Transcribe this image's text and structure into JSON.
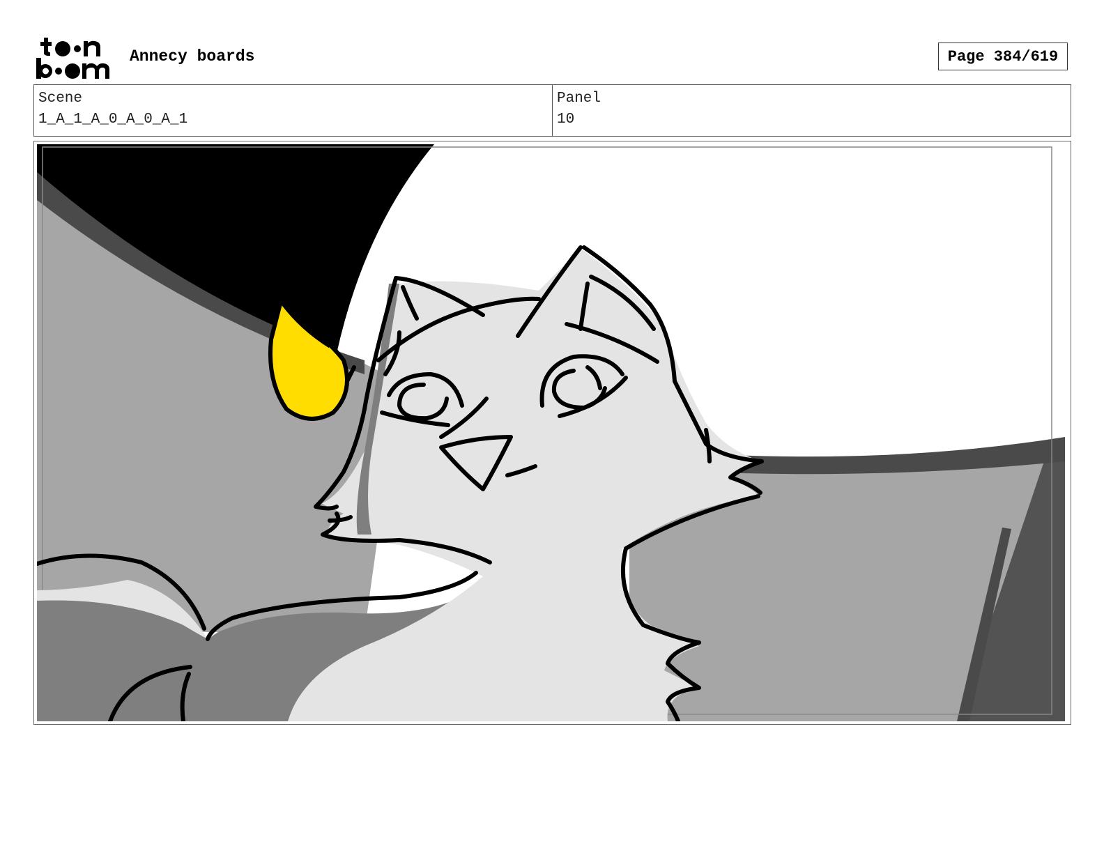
{
  "header": {
    "logo_text": "toon boom",
    "app_title": "Annecy boards",
    "page_counter": "Page 384/619"
  },
  "info": {
    "scene_label": "Scene",
    "scene_value": "1_A_1_A_0_A_0_A_1",
    "panel_label": "Panel",
    "panel_value": "10"
  },
  "colors": {
    "accent_yellow": "#FFDD00",
    "dark_gray": "#4a4a4a",
    "mid_gray": "#a6a6a6",
    "light_gray": "#e4e4e4",
    "shadow_gray": "#7f7f7f"
  }
}
